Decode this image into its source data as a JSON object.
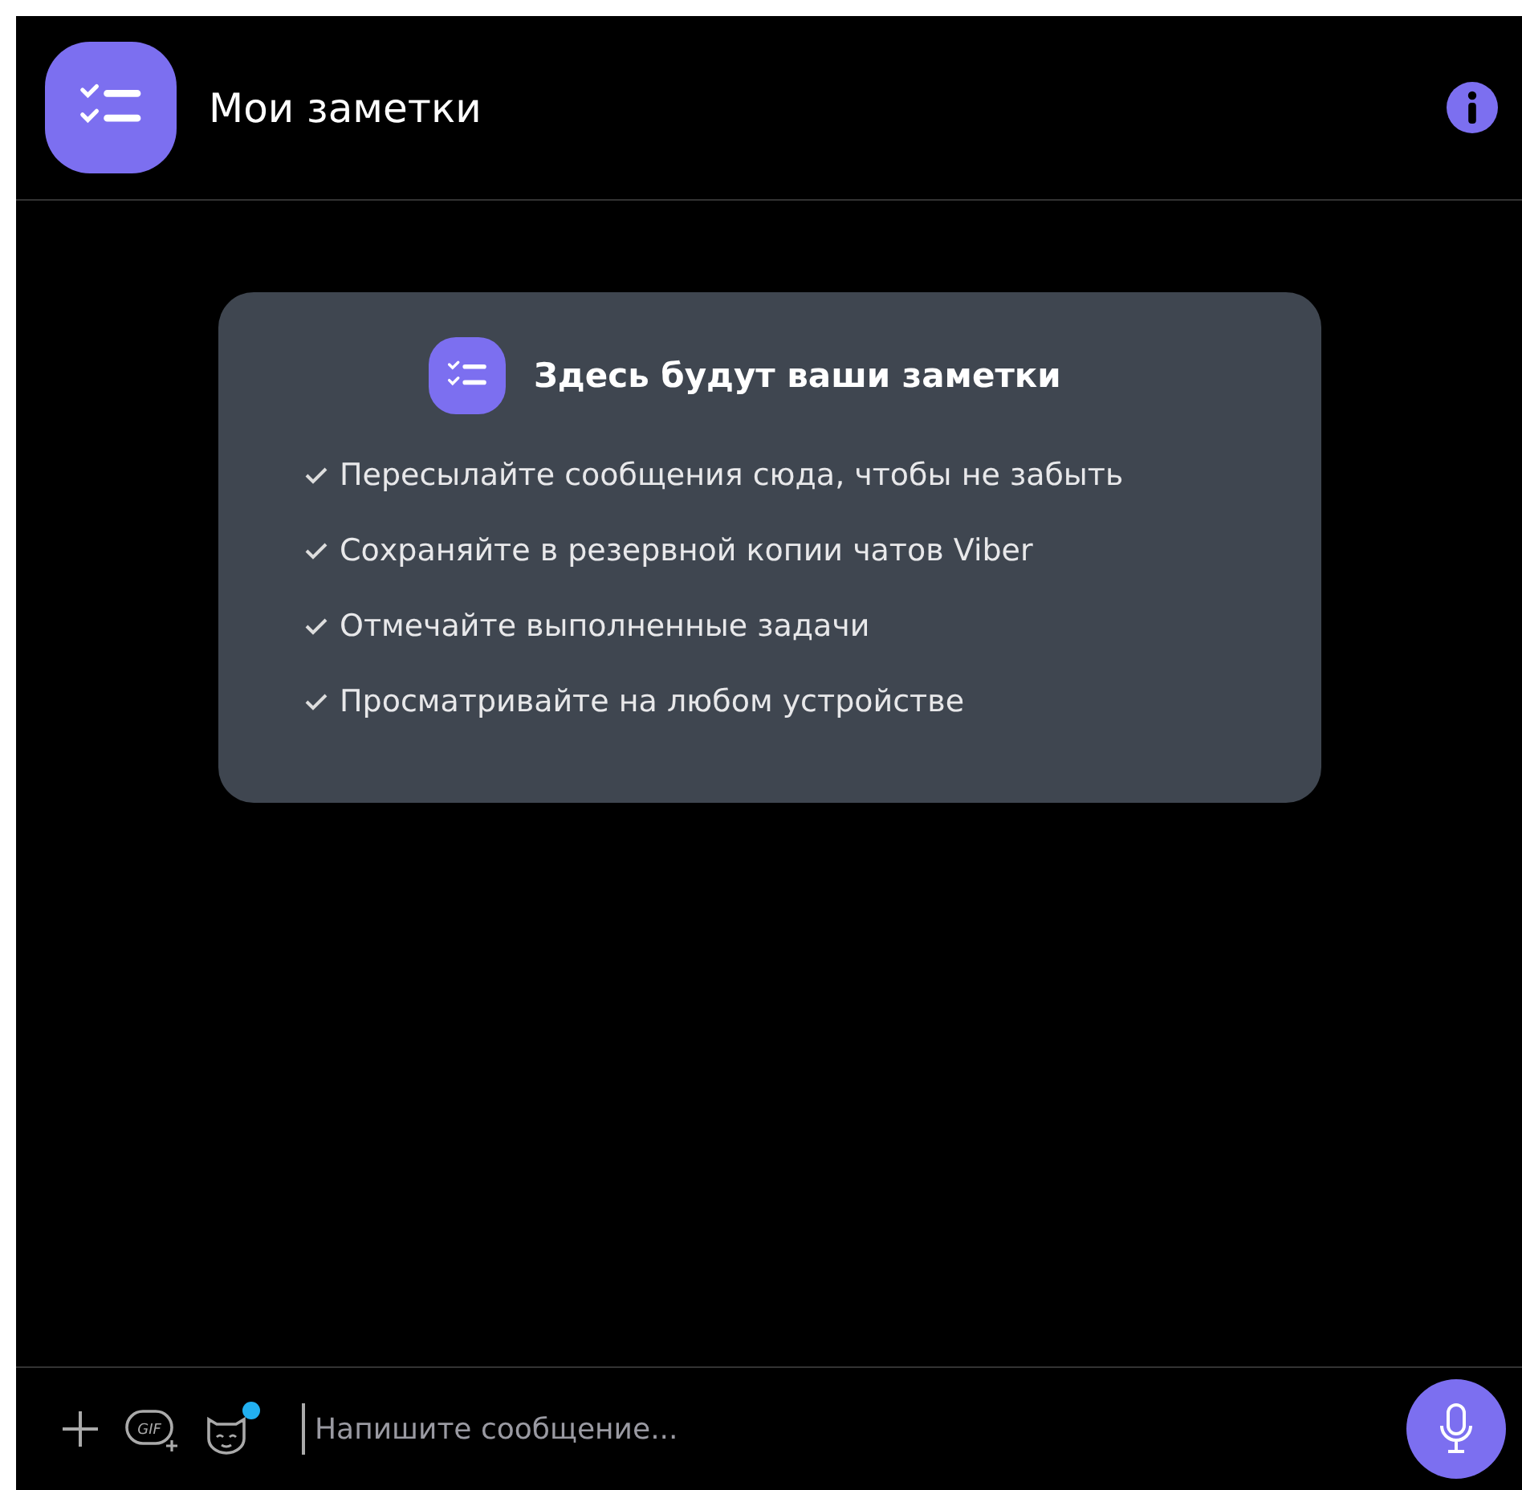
{
  "header": {
    "title": "Мои заметки"
  },
  "card": {
    "title": "Здесь будут ваши заметки",
    "items": [
      {
        "text": "Пересылайте сообщения сюда, чтобы не забыть"
      },
      {
        "text": "Сохраняйте в резервной копии чатов Viber"
      },
      {
        "text": "Отмечайте выполненные задачи"
      },
      {
        "text": "Просматривайте на любом устройстве"
      }
    ]
  },
  "composer": {
    "gif_label": "GIF",
    "sticker_badge": true,
    "placeholder": "Напишите сообщение..."
  }
}
